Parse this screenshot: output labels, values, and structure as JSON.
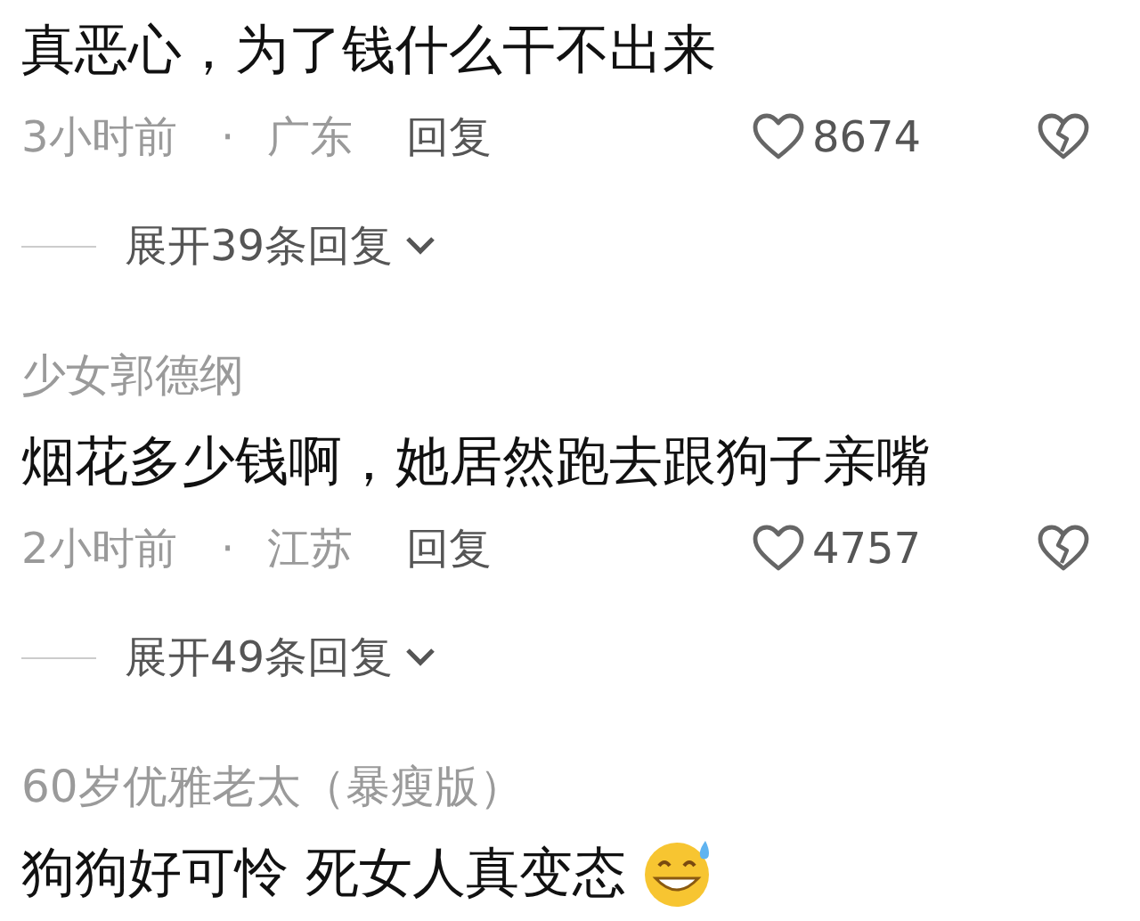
{
  "comments": [
    {
      "text": "真恶心，为了钱什么干不出来",
      "time": "3小时前",
      "separator": "·",
      "location": "广东",
      "reply": "回复",
      "likes": "8674",
      "expand": "展开39条回复"
    },
    {
      "username": "少女郭德纲",
      "text": "烟花多少钱啊，她居然跑去跟狗子亲嘴",
      "time": "2小时前",
      "separator": "·",
      "location": "江苏",
      "reply": "回复",
      "likes": "4757",
      "expand": "展开49条回复"
    },
    {
      "username": "60岁优雅老太（暴瘦版）",
      "text": "狗狗好可怜 死女人真变态",
      "emoji": true
    }
  ]
}
